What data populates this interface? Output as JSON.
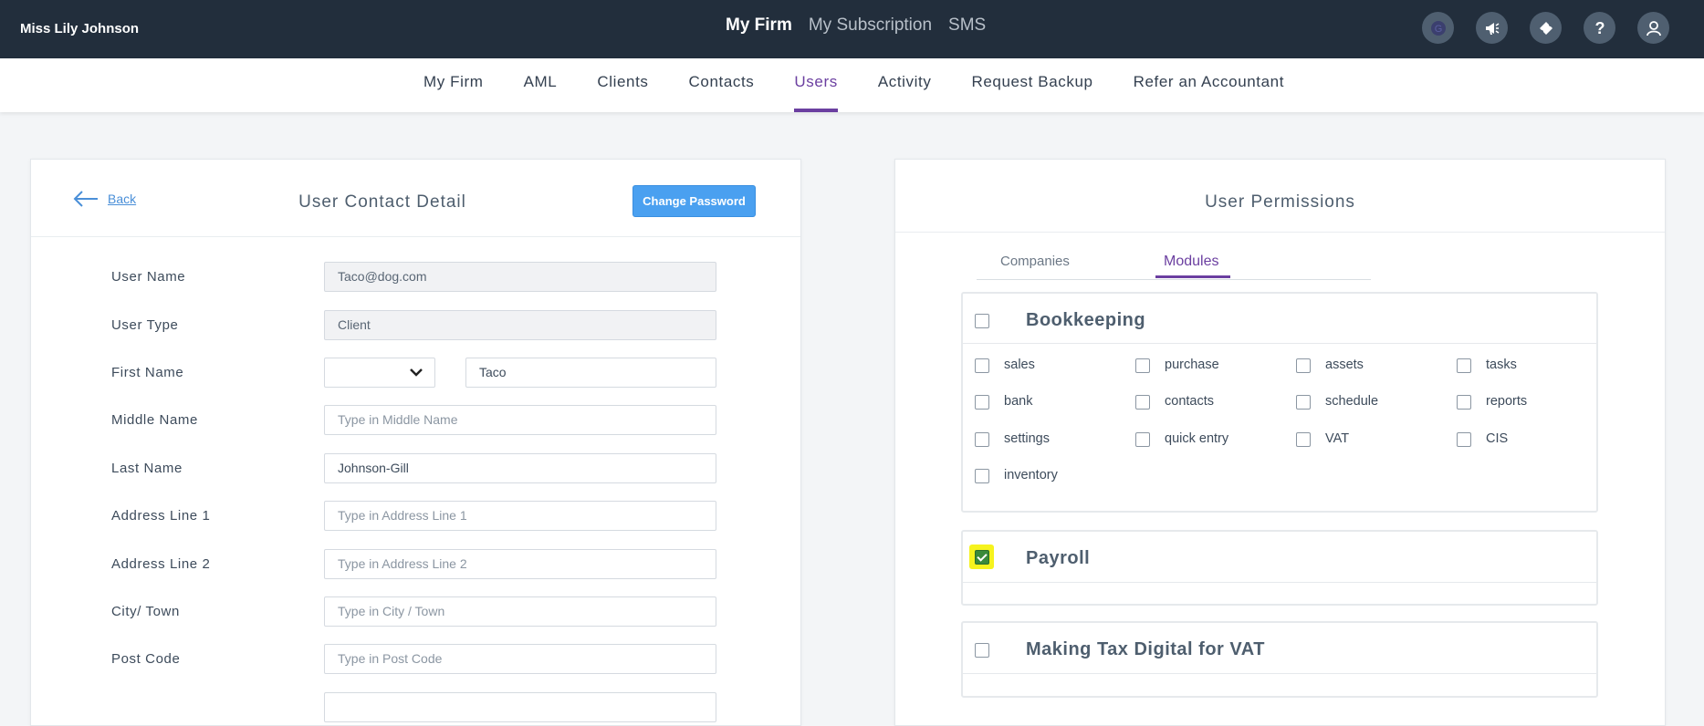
{
  "topbar": {
    "user_name": "Miss Lily Johnson",
    "links": [
      "My Firm",
      "My Subscription",
      "SMS"
    ],
    "icons": [
      "g-icon",
      "megaphone-icon",
      "ticket-icon",
      "help-icon",
      "user-icon"
    ]
  },
  "nav": {
    "items": [
      "My Firm",
      "AML",
      "Clients",
      "Contacts",
      "Users",
      "Activity",
      "Request Backup",
      "Refer an Accountant"
    ],
    "active": "Users"
  },
  "left": {
    "back_label": "Back",
    "title": "User Contact Detail",
    "change_password": "Change Password",
    "fields": {
      "user_name": {
        "label": "User Name",
        "value": "Taco@dog.com"
      },
      "user_type": {
        "label": "User Type",
        "value": "Client"
      },
      "first_name": {
        "label": "First Name",
        "title_value": "",
        "value": "Taco"
      },
      "middle_name": {
        "label": "Middle Name",
        "placeholder": "Type in Middle Name"
      },
      "last_name": {
        "label": "Last Name",
        "value": "Johnson-Gill"
      },
      "address1": {
        "label": "Address Line 1",
        "placeholder": "Type in Address Line 1"
      },
      "address2": {
        "label": "Address Line 2",
        "placeholder": "Type in Address Line 2"
      },
      "city": {
        "label": "City/ Town",
        "placeholder": "Type in City / Town"
      },
      "postcode": {
        "label": "Post Code",
        "placeholder": "Type in Post Code"
      }
    }
  },
  "right": {
    "title": "User Permissions",
    "tabs": [
      "Companies",
      "Modules"
    ],
    "active_tab": "Modules",
    "modules": [
      {
        "title": "Bookkeeping",
        "checked": false,
        "items": [
          "sales",
          "purchase",
          "assets",
          "tasks",
          "bank",
          "contacts",
          "schedule",
          "reports",
          "settings",
          "quick entry",
          "VAT",
          "CIS",
          "inventory"
        ]
      },
      {
        "title": "Payroll",
        "checked": true,
        "items": []
      },
      {
        "title": "Making Tax Digital for VAT",
        "checked": false,
        "items": []
      }
    ]
  },
  "colors": {
    "accent": "#6b3fa0",
    "topbar": "#222e3c",
    "button": "#4aa0f0",
    "highlight": "#f6f31e"
  }
}
